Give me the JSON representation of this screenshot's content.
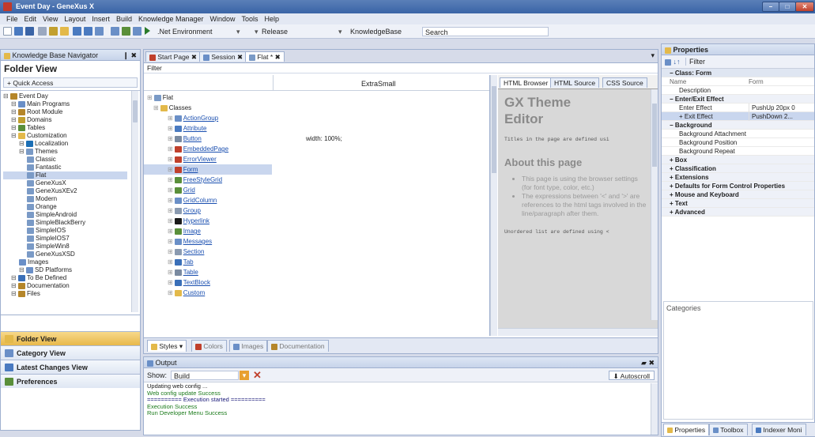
{
  "window": {
    "title": "Event Day - GeneXus X"
  },
  "menu": [
    "File",
    "Edit",
    "View",
    "Layout",
    "Insert",
    "Build",
    "Knowledge Manager",
    "Window",
    "Tools",
    "Help"
  ],
  "toolbar": {
    "environment": ".Net Environment",
    "config": "Release",
    "kb": "KnowledgeBase",
    "search": "Search"
  },
  "kbnav": {
    "title": "Knowledge Base Navigator",
    "pin": "❙ ✖",
    "header": "Folder View",
    "quick": "Quick Access",
    "tree": [
      {
        "d": 0,
        "t": "Event Day",
        "c": "#b5862a"
      },
      {
        "d": 1,
        "t": "Main Programs",
        "c": "#6a8fc7"
      },
      {
        "d": 1,
        "t": "Root Module",
        "c": "#b5862a"
      },
      {
        "d": 1,
        "t": "Domains",
        "c": "#c2a030"
      },
      {
        "d": 1,
        "t": "Tables",
        "c": "#5a8f3a"
      },
      {
        "d": 1,
        "t": "Customization",
        "c": "#e3b94a"
      },
      {
        "d": 2,
        "t": "Localization",
        "c": "#1c6fb5"
      },
      {
        "d": 2,
        "t": "Themes",
        "c": "#7a9ac6"
      },
      {
        "d": 3,
        "t": "Classic",
        "c": "#7a9ac6"
      },
      {
        "d": 3,
        "t": "Fantastic",
        "c": "#7a9ac6"
      },
      {
        "d": 3,
        "t": "Flat",
        "c": "#7a9ac6",
        "sel": true
      },
      {
        "d": 3,
        "t": "GeneXusX",
        "c": "#7a9ac6"
      },
      {
        "d": 3,
        "t": "GeneXusXEv2",
        "c": "#7a9ac6"
      },
      {
        "d": 3,
        "t": "Modern",
        "c": "#7a9ac6"
      },
      {
        "d": 3,
        "t": "Orange",
        "c": "#7a9ac6"
      },
      {
        "d": 3,
        "t": "SimpleAndroid",
        "c": "#7a9ac6"
      },
      {
        "d": 3,
        "t": "SimpleBlackBerry",
        "c": "#7a9ac6"
      },
      {
        "d": 3,
        "t": "SimpleIOS",
        "c": "#7a9ac6"
      },
      {
        "d": 3,
        "t": "SimpleIOS7",
        "c": "#7a9ac6"
      },
      {
        "d": 3,
        "t": "SimpleWin8",
        "c": "#7a9ac6"
      },
      {
        "d": 3,
        "t": "GeneXusXSD",
        "c": "#7a9ac6"
      },
      {
        "d": 2,
        "t": "Images",
        "c": "#6a8fc7"
      },
      {
        "d": 2,
        "t": "SD Platforms",
        "c": "#6a8fc7"
      },
      {
        "d": 1,
        "t": "To Be Defined",
        "c": "#3a6fb8"
      },
      {
        "d": 1,
        "t": "Documentation",
        "c": "#b5862a"
      },
      {
        "d": 1,
        "t": "Files",
        "c": "#b5862a"
      }
    ],
    "nav": [
      {
        "t": "Folder View",
        "c": "#e3b94a"
      },
      {
        "t": "Category View",
        "c": "#6a8fc7"
      },
      {
        "t": "Latest Changes View",
        "c": "#4a7ac0"
      },
      {
        "t": "Preferences",
        "c": "#5a8f3a"
      }
    ]
  },
  "doc": {
    "tabs": [
      "Start Page",
      "Session",
      "Flat *"
    ],
    "filter": "Filter",
    "col_header": "ExtraSmall",
    "width_val": "width: 100%;",
    "classes_root": "Flat",
    "classes_folder": "Classes",
    "classes": [
      "ActionGroup",
      "Attribute",
      "Button",
      "EmbeddedPage",
      "ErrorViewer",
      "Form",
      "FreeStyleGrid",
      "Grid",
      "GridColumn",
      "Group",
      "Hyperlink",
      "Image",
      "Messages",
      "Section",
      "Tab",
      "Table",
      "TextBlock",
      "Custom"
    ],
    "class_colors": [
      "#6a8fc7",
      "#4a7ac0",
      "#7a8aa0",
      "#c0402c",
      "#c0402c",
      "#c0402c",
      "#5a8f3a",
      "#5a8f3a",
      "#6a8fc7",
      "#8a9ab0",
      "#1a1a1a",
      "#5a8f3a",
      "#6a8fc7",
      "#8a9ab0",
      "#3a6fb8",
      "#7a8aa0",
      "#3a6fb8",
      "#e3b94a"
    ],
    "bottom_tabs": [
      "Styles",
      "Colors",
      "Images",
      "Documentation"
    ]
  },
  "preview": {
    "tabs": [
      "HTML Browser",
      "HTML Source",
      "CSS Source"
    ],
    "title1": "GX Theme",
    "title2": "Editor",
    "mono1": "Titles in the page are defined usi",
    "about": "About this page",
    "bullets": [
      "This page is using the browser settings (for font type, color, etc.)",
      "The expressions between '<' and '>' are references to the html tags involved in the line/paragraph after them."
    ],
    "mono2": "Unordered list are defined using <"
  },
  "properties": {
    "title": "Properties",
    "filter": "Filter",
    "cat": "Class: Form",
    "col_name": "Name",
    "col_value": "Form",
    "rows": [
      {
        "k": "Description",
        "v": "",
        "cat": false
      },
      {
        "k": "Enter/Exit Effect",
        "v": "",
        "cat": true
      },
      {
        "k": "Enter Effect",
        "v": "PushUp 20px 0",
        "cat": false
      },
      {
        "k": "Exit Effect",
        "v": "PushDown 2...",
        "cat": false
      },
      {
        "k": "Background",
        "v": "",
        "cat": true
      },
      {
        "k": "Background Attachment",
        "v": "",
        "cat": false
      },
      {
        "k": "Background Position",
        "v": "",
        "cat": false
      },
      {
        "k": "Background Repeat",
        "v": "",
        "cat": false
      },
      {
        "k": "Box",
        "v": "",
        "cat": true
      },
      {
        "k": "Classification",
        "v": "",
        "cat": true
      },
      {
        "k": "Extensions",
        "v": "",
        "cat": true
      },
      {
        "k": "Defaults for Form Control Properties",
        "v": "",
        "cat": true
      },
      {
        "k": "Mouse and Keyboard",
        "v": "",
        "cat": true
      },
      {
        "k": "Text",
        "v": "",
        "cat": true
      },
      {
        "k": "Advanced",
        "v": "",
        "cat": true
      }
    ],
    "categories": "Categories",
    "bottom_tabs": [
      "Properties",
      "Toolbox",
      "Indexer Moni"
    ]
  },
  "output": {
    "title": "Output",
    "show": "Show:",
    "build": "Build",
    "autoscroll": "Autoscroll",
    "lines": [
      {
        "t": "Updating web config ...",
        "c": "#1a1a1a"
      },
      {
        "t": "Web config update Success",
        "c": "#1a7a1a"
      },
      {
        "t": "========== Execution started ==========",
        "c": "#1a1a7a"
      },
      {
        "t": "Execution Success",
        "c": "#1a7a1a"
      },
      {
        "t": "Run Developer Menu Success",
        "c": "#1a7a1a"
      }
    ]
  },
  "colors": {
    "accent": "#3a64a6",
    "selection": "#c9d6ee"
  }
}
